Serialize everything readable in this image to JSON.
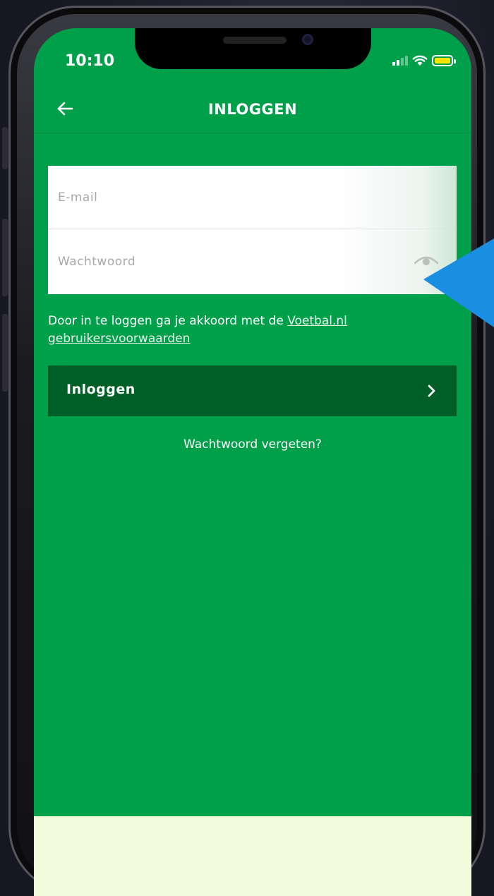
{
  "status_bar": {
    "time": "10:10"
  },
  "header": {
    "title": "INLOGGEN"
  },
  "form": {
    "email_placeholder": "E-mail",
    "password_placeholder": "Wachtwoord"
  },
  "terms": {
    "text": "Door in te loggen ga je akkoord met de ",
    "link_part1": "Voetbal.nl",
    "link_part2": "gebruikersvoorwaarden"
  },
  "login_button": {
    "label": "Inloggen"
  },
  "forgot_password": {
    "label": "Wachtwoord vergeten?"
  },
  "icons": [
    "arrow-left-icon",
    "eye-icon",
    "chevron-right-icon",
    "signal-icon",
    "wifi-icon",
    "battery-icon"
  ],
  "colors": {
    "screen_background": "#00a04a",
    "button_background": "#005f27",
    "callout_arrow": "#1a8ee0",
    "bottom_bar": "#f2fbdc"
  }
}
